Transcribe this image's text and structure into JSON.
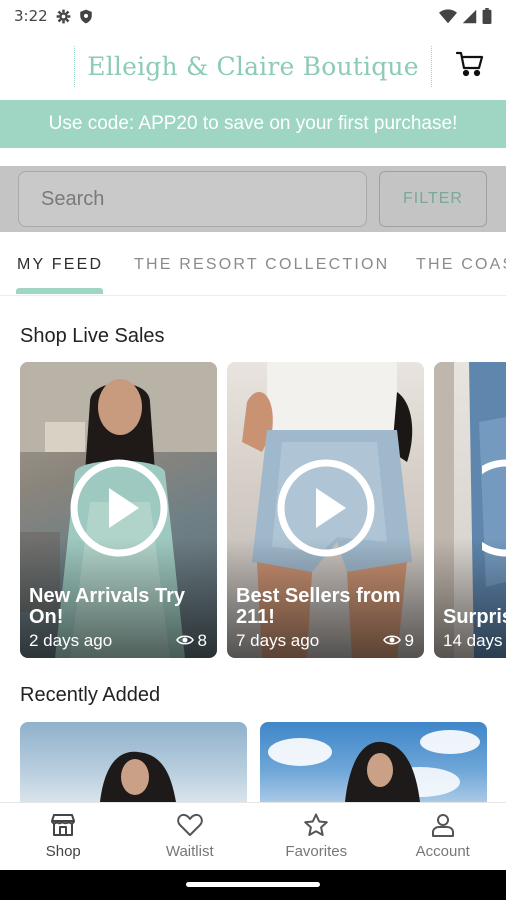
{
  "status_bar": {
    "time": "3:22",
    "icons": [
      "gear-icon",
      "shield-icon",
      "wifi-icon",
      "signal-icon",
      "battery-icon"
    ]
  },
  "header": {
    "brand": "Elleigh & Claire Boutique",
    "cart_icon": "cart-icon"
  },
  "promo": {
    "text": "Use code: APP20 to save on your first purchase!",
    "color": "#9fd6c3"
  },
  "search": {
    "placeholder": "Search",
    "value": "",
    "filter_label": "FILTER"
  },
  "tabs": [
    {
      "label": "MY FEED",
      "active": true
    },
    {
      "label": "THE RESORT COLLECTION",
      "active": false
    },
    {
      "label": "THE COAS",
      "active": false
    }
  ],
  "live_sales": {
    "title": "Shop Live Sales",
    "items": [
      {
        "title": "New Arrivals Try On!",
        "age": "2 days ago",
        "views": "8"
      },
      {
        "title": "Best Sellers from 211!",
        "age": "7 days ago",
        "views": "9"
      },
      {
        "title": "Surpris Fill-a-Ba",
        "age": "14 days",
        "views": ""
      }
    ]
  },
  "recently_added": {
    "title": "Recently Added"
  },
  "bottom_nav": [
    {
      "label": "Shop",
      "icon": "store-icon",
      "active": true
    },
    {
      "label": "Waitlist",
      "icon": "heart-icon",
      "active": false
    },
    {
      "label": "Favorites",
      "icon": "star-icon",
      "active": false
    },
    {
      "label": "Account",
      "icon": "person-icon",
      "active": false
    }
  ]
}
